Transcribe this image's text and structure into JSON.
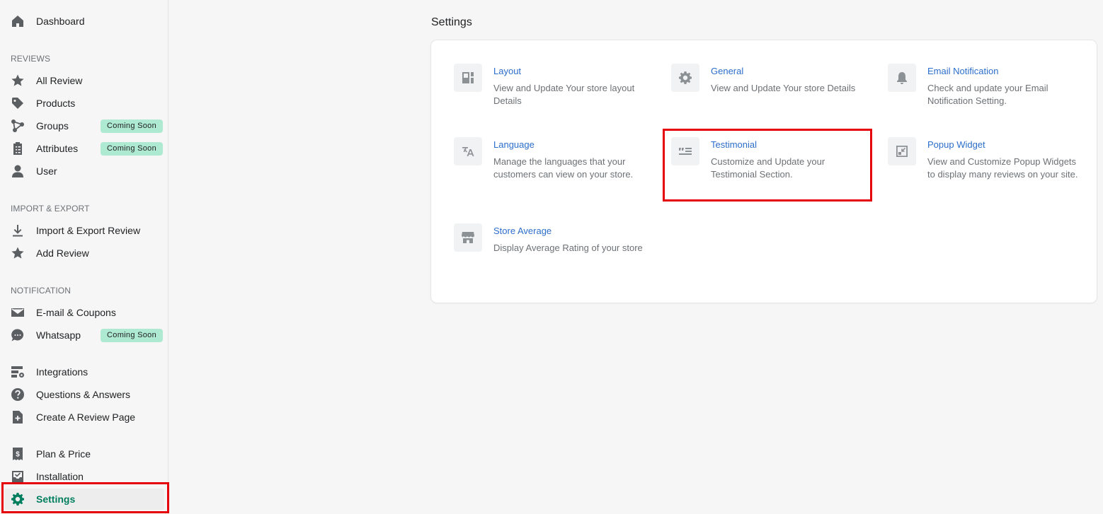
{
  "sidebar": {
    "dashboard": "Dashboard",
    "sections": {
      "reviews": "REVIEWS",
      "import_export": "IMPORT & EXPORT",
      "notification": "NOTIFICATION"
    },
    "items": {
      "all_review": "All Review",
      "products": "Products",
      "groups": "Groups",
      "attributes": "Attributes",
      "user": "User",
      "import_export_review": "Import & Export Review",
      "add_review": "Add Review",
      "email_coupons": "E-mail & Coupons",
      "whatsapp": "Whatsapp",
      "integrations": "Integrations",
      "questions_answers": "Questions & Answers",
      "create_review_page": "Create A Review Page",
      "plan_price": "Plan & Price",
      "installation": "Installation",
      "settings": "Settings"
    },
    "badge_coming_soon": "Coming Soon"
  },
  "main": {
    "title": "Settings",
    "settings": {
      "layout": {
        "title": "Layout",
        "desc": "View and Update Your store layout Details"
      },
      "general": {
        "title": "General",
        "desc": "View and Update Your store Details"
      },
      "email_notification": {
        "title": "Email Notification",
        "desc": "Check and update your Email Notification Setting."
      },
      "language": {
        "title": "Language",
        "desc": "Manage the languages that your customers can view on your store."
      },
      "testimonial": {
        "title": "Testimonial",
        "desc": "Customize and Update your Testimonial Section."
      },
      "popup_widget": {
        "title": "Popup Widget",
        "desc": "View and Customize Popup Widgets to display many reviews on your site."
      },
      "store_average": {
        "title": "Store Average",
        "desc": "Display Average Rating of your store"
      }
    }
  },
  "colors": {
    "accent": "#007f5f",
    "link": "#2c6ecb",
    "badge": "#aee9d1",
    "highlight": "#e5000b"
  }
}
